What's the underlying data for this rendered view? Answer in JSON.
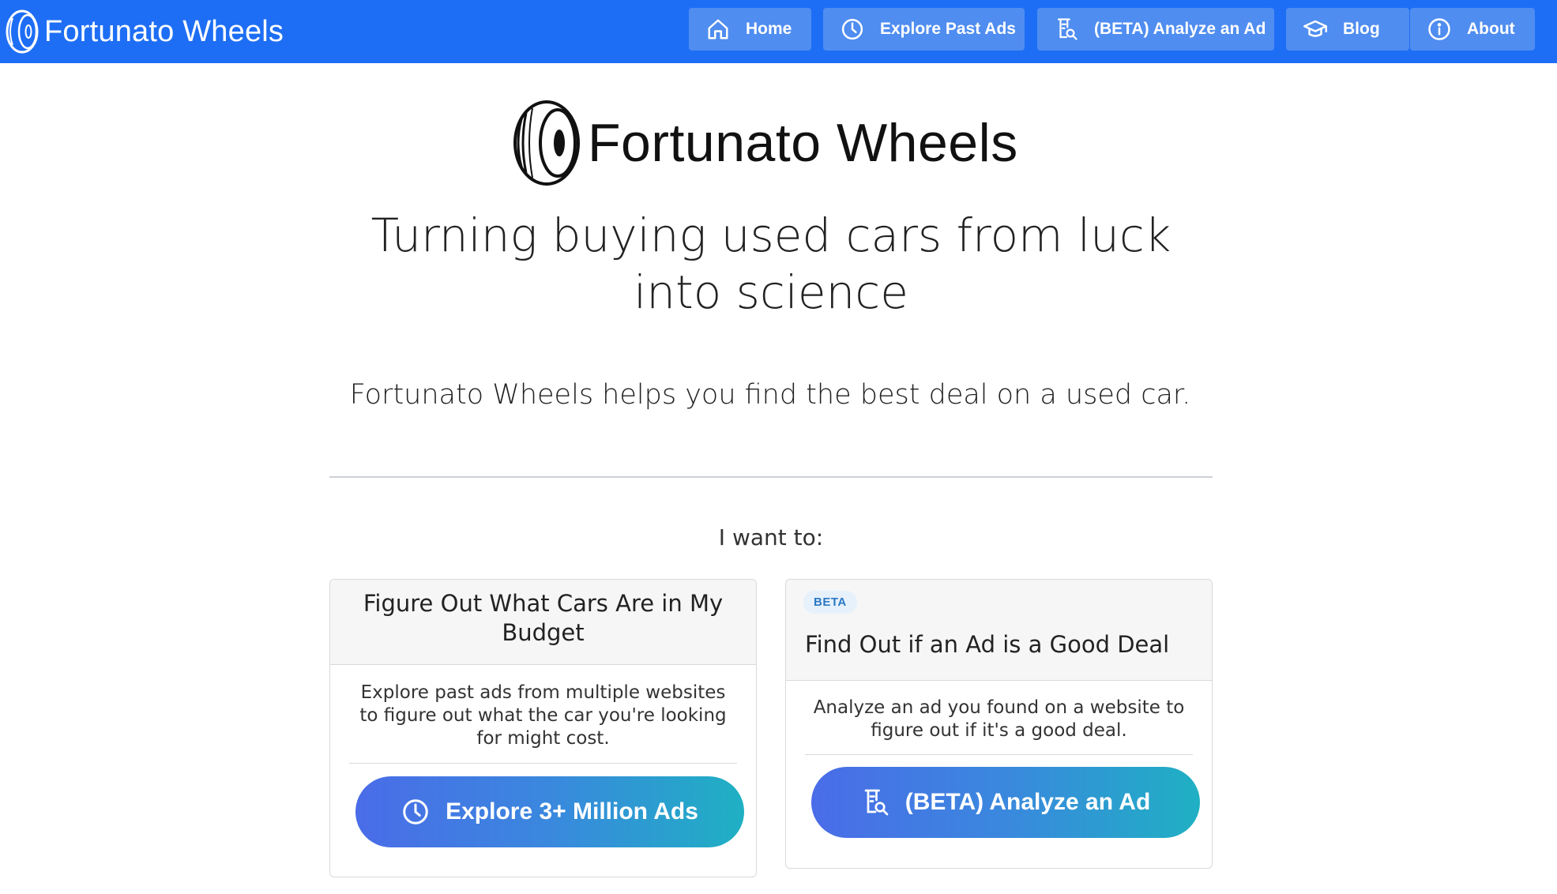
{
  "navbar": {
    "brand": "Fortunato Wheels",
    "brand_icon": "tire-logo-icon",
    "background": "#1e6ef5",
    "items": [
      {
        "label": "Home",
        "icon": "home-icon"
      },
      {
        "label": "Explore Past Ads",
        "icon": "clock-icon"
      },
      {
        "label": "(BETA) Analyze an Ad",
        "icon": "document-search-icon"
      },
      {
        "label": "Blog",
        "icon": "graduation-cap-icon"
      },
      {
        "label": "About",
        "icon": "info-icon"
      }
    ]
  },
  "hero": {
    "logo_text": "Fortunato Wheels",
    "tagline": "Turning buying used cars from luck into science",
    "subtitle": "Fortunato Wheels helps you find the best deal on a used car."
  },
  "options": {
    "prompt": "I want to:",
    "cards": [
      {
        "title": "Figure Out What Cars Are in My Budget",
        "description": "Explore past ads from multiple websites to figure out what the car you're looking for might cost.",
        "button_label": "Explore 3+ Million Ads",
        "button_icon": "clock-icon"
      },
      {
        "badge": "BETA",
        "title": "Find Out if an Ad is a Good Deal",
        "description": "Analyze an ad you found on a website to figure out if it's a good deal.",
        "button_label": "(BETA) Analyze an Ad",
        "button_icon": "document-search-icon"
      }
    ]
  },
  "colors": {
    "button_gradient_start": "#4a6ce8",
    "button_gradient_end": "#1fb0c3",
    "badge_background": "#e6f1fb",
    "badge_text": "#2b78c4"
  }
}
